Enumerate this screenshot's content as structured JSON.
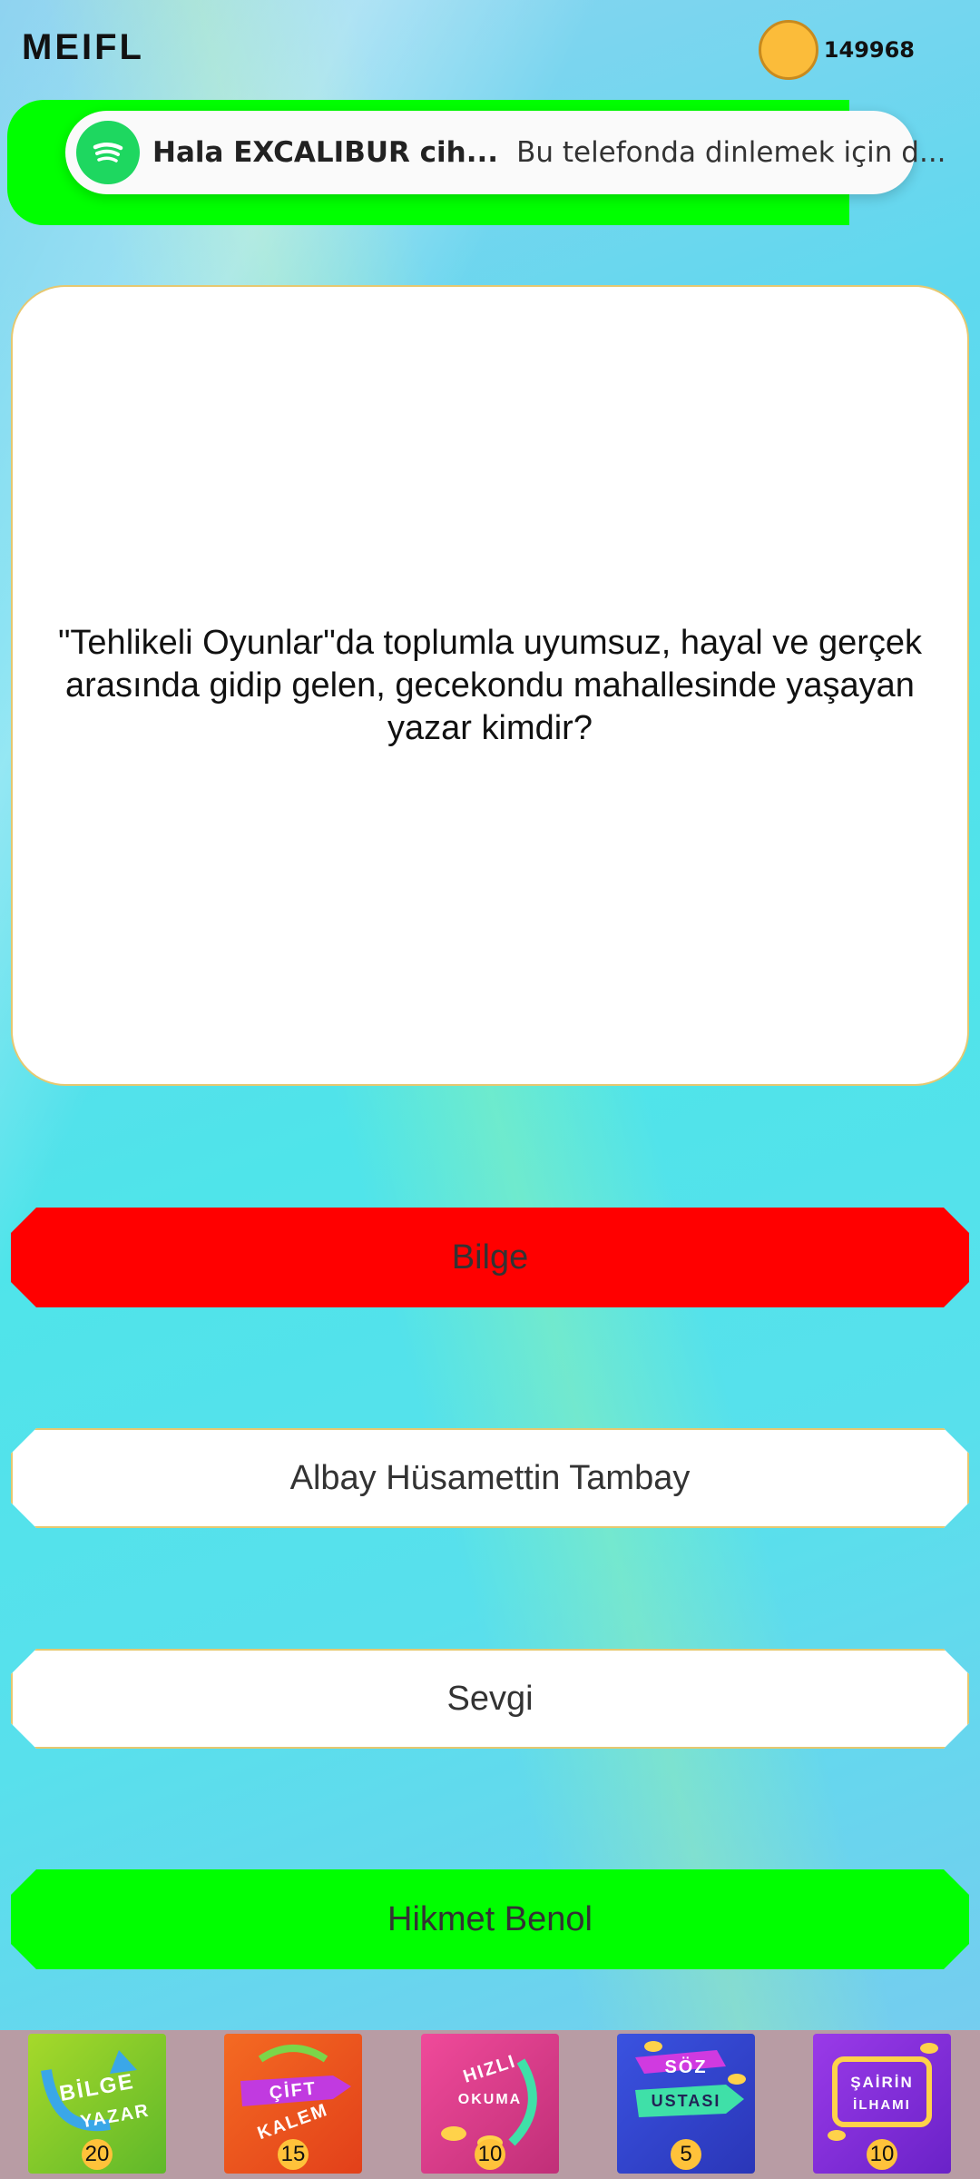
{
  "header": {
    "app_title": "MEIFL",
    "coin_count": "149968"
  },
  "notification": {
    "icon": "spotify-icon",
    "title": "Hala EXCALIBUR cih...",
    "body": "Bu telefonda dinlemek için d..."
  },
  "question": {
    "text": "\"Tehlikeli Oyunlar\"da toplumla uyumsuz, hayal ve gerçek arasında gidip gelen, gecekondu mahallesinde yaşayan yazar kimdir?"
  },
  "answers": [
    {
      "label": "Bilge",
      "state": "wrong",
      "color": "#ff0000"
    },
    {
      "label": "Albay Hüsamettin Tambay",
      "state": "neutral",
      "color": "#ffffff"
    },
    {
      "label": "Sevgi",
      "state": "neutral",
      "color": "#ffffff"
    },
    {
      "label": "Hikmet Benol",
      "state": "correct",
      "color": "#00ff00"
    }
  ],
  "powerups": [
    {
      "line1": "BİLGE",
      "line2": "YAZAR",
      "count": "20"
    },
    {
      "line1": "ÇİFT",
      "line2": "KALEM",
      "count": "15"
    },
    {
      "line1": "HIZLI",
      "line2": "OKUMA",
      "count": "10"
    },
    {
      "line1": "SÖZ",
      "line2": "USTASI",
      "count": "5"
    },
    {
      "line1": "ŞAİRİN",
      "line2": "İLHAMI",
      "count": "10"
    }
  ]
}
